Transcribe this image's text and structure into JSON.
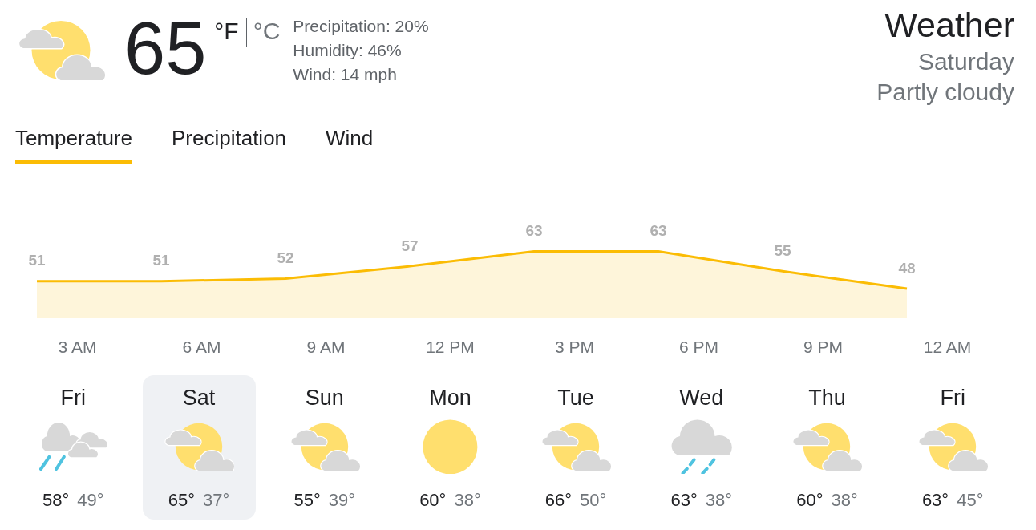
{
  "current": {
    "kind": "partly_cloudy",
    "temperature": "65",
    "units": [
      {
        "label": "°F",
        "selected": true
      },
      {
        "label": "°C",
        "selected": false
      }
    ],
    "details": [
      "Precipitation: 20%",
      "Humidity: 46%",
      "Wind: 14 mph"
    ]
  },
  "header": {
    "title": "Weather",
    "day": "Saturday",
    "condition": "Partly cloudy"
  },
  "tabs": [
    {
      "label": "Temperature",
      "selected": true
    },
    {
      "label": "Precipitation",
      "selected": false
    },
    {
      "label": "Wind",
      "selected": false
    }
  ],
  "chart_data": {
    "type": "area",
    "categories": [
      null,
      null,
      null,
      null,
      null,
      null,
      null,
      null
    ],
    "series": [
      {
        "color": "#fbbc04",
        "values": [
          51,
          51,
          52,
          57,
          63,
          63,
          55,
          48
        ]
      }
    ],
    "data_labels": true
  },
  "time_labels": [
    "3 AM",
    "6 AM",
    "9 AM",
    "12 PM",
    "3 PM",
    "6 PM",
    "9 PM",
    "12 AM"
  ],
  "days": [
    {
      "day": "Fri",
      "kind": "showers",
      "high": "58°",
      "low": "49°",
      "selected": false
    },
    {
      "day": "Sat",
      "kind": "partly_cloudy",
      "high": "65°",
      "low": "37°",
      "selected": true
    },
    {
      "day": "Sun",
      "kind": "partly_cloudy",
      "high": "55°",
      "low": "39°",
      "selected": false
    },
    {
      "day": "Mon",
      "kind": "sunny",
      "high": "60°",
      "low": "38°",
      "selected": false
    },
    {
      "day": "Tue",
      "kind": "partly_cloudy",
      "high": "66°",
      "low": "50°",
      "selected": false
    },
    {
      "day": "Wed",
      "kind": "rain",
      "high": "63°",
      "low": "38°",
      "selected": false
    },
    {
      "day": "Thu",
      "kind": "partly_cloudy",
      "high": "60°",
      "low": "38°",
      "selected": false
    },
    {
      "day": "Fri",
      "kind": "partly_cloudy",
      "high": "63°",
      "low": "45°",
      "selected": false
    }
  ]
}
